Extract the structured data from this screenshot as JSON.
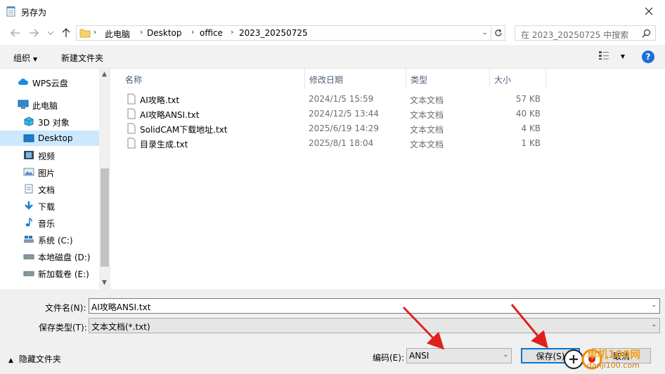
{
  "window": {
    "title": "另存为"
  },
  "address": {
    "crumbs": [
      "此电脑",
      "Desktop",
      "office",
      "2023_20250725"
    ],
    "search_placeholder": "在 2023_20250725 中搜索"
  },
  "toolbar": {
    "organize": "组织",
    "new_folder": "新建文件夹",
    "help": "?"
  },
  "nav": {
    "items": [
      {
        "label": "WPS云盘",
        "icon": "cloud-icon"
      },
      {
        "label": "此电脑",
        "icon": "pc-icon"
      },
      {
        "label": "3D 对象",
        "icon": "3d-objects-icon"
      },
      {
        "label": "Desktop",
        "icon": "desktop-icon",
        "selected": true
      },
      {
        "label": "视频",
        "icon": "video-icon"
      },
      {
        "label": "图片",
        "icon": "pictures-icon"
      },
      {
        "label": "文档",
        "icon": "documents-icon"
      },
      {
        "label": "下载",
        "icon": "download-icon"
      },
      {
        "label": "音乐",
        "icon": "music-icon"
      },
      {
        "label": "系统 (C:)",
        "icon": "drive-c-icon"
      },
      {
        "label": "本地磁盘 (D:)",
        "icon": "drive-icon"
      },
      {
        "label": "新加载卷 (E:)",
        "icon": "drive-icon"
      }
    ]
  },
  "files": {
    "columns": [
      "名称",
      "修改日期",
      "类型",
      "大小"
    ],
    "rows": [
      {
        "name": "AI攻略.txt",
        "date": "2024/1/5 15:59",
        "type": "文本文档",
        "size": "57 KB"
      },
      {
        "name": "AI攻略ANSI.txt",
        "date": "2024/12/5 13:44",
        "type": "文本文档",
        "size": "40 KB"
      },
      {
        "name": "SolidCAM下载地址.txt",
        "date": "2025/6/19 14:29",
        "type": "文本文档",
        "size": "4 KB"
      },
      {
        "name": "目录生成.txt",
        "date": "2025/8/1 18:04",
        "type": "文本文档",
        "size": "1 KB"
      }
    ]
  },
  "form": {
    "filename_label": "文件名(N):",
    "filename_value": "AI攻略ANSI.txt",
    "filetype_label": "保存类型(T):",
    "filetype_value": "文本文档(*.txt)",
    "encoding_label": "编码(E):",
    "encoding_value": "ANSI",
    "save_label": "保存(S)",
    "cancel_label": "取消",
    "hide_folders": "隐藏文件夹"
  },
  "watermark": {
    "line1": "单机100网",
    "line2": "danji100.com"
  },
  "colors": {
    "selected": "#cce8ff",
    "accent": "#0078d7",
    "arrow": "#e02020",
    "help": "#1c6fd6"
  }
}
